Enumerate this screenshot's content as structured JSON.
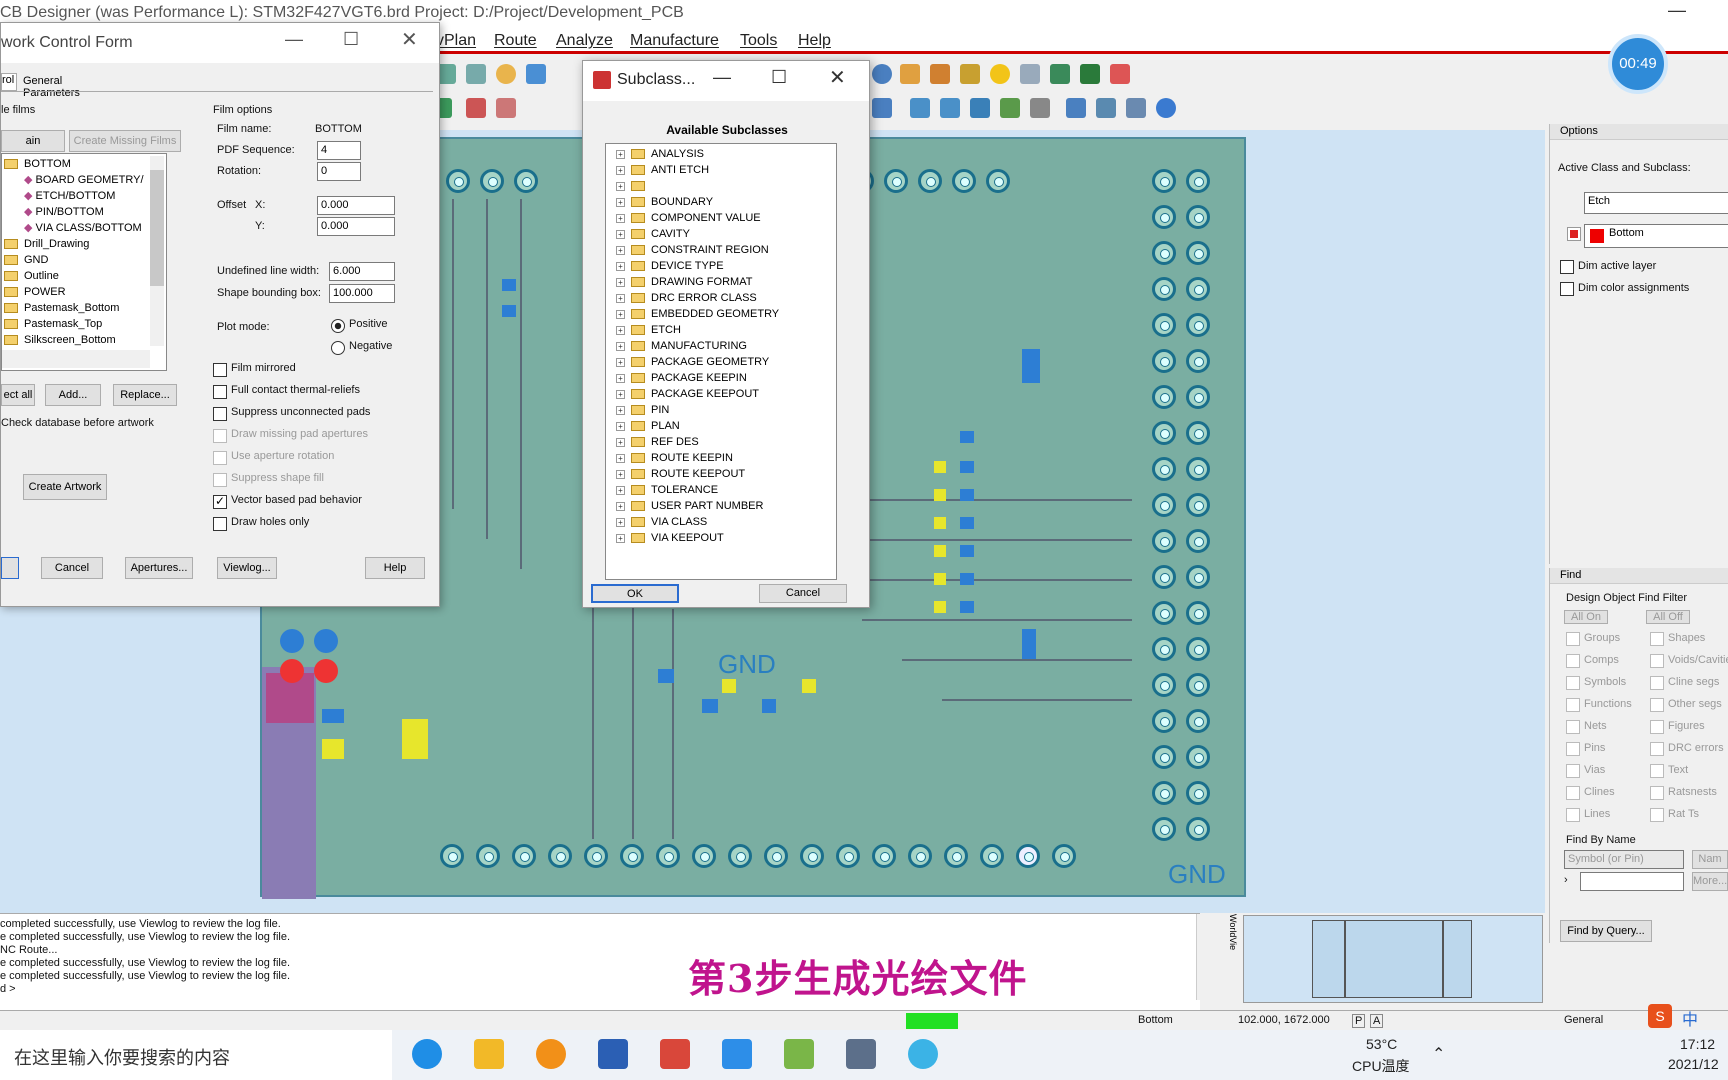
{
  "window": {
    "title": "CB Designer (was Performance L): STM32F427VGT6.brd  Project: D:/Project/Development_PCB"
  },
  "menu": {
    "items": [
      "vPlan",
      "Route",
      "Analyze",
      "Manufacture",
      "Tools",
      "Help"
    ]
  },
  "timer": "00:49",
  "artwork": {
    "title": "work Control Form",
    "tabs": [
      "rol",
      "General Parameters"
    ],
    "films_label": "le films",
    "btn_main_selection": "ain Selection",
    "btn_create_missing": "Create Missing Films",
    "films": [
      "BOTTOM",
      "BOARD GEOMETRY/",
      "ETCH/BOTTOM",
      "PIN/BOTTOM",
      "VIA CLASS/BOTTOM",
      "Drill_Drawing",
      "GND",
      "Outline",
      "POWER",
      "Pastemask_Bottom",
      "Pastemask_Top",
      "Silkscreen_Bottom"
    ],
    "film_options_label": "Film options",
    "film_name_label": "Film name:",
    "film_name": "BOTTOM",
    "pdf_seq_label": "PDF Sequence:",
    "pdf_seq": "4",
    "rotation_label": "Rotation:",
    "rotation": "0",
    "offset_label": "Offset",
    "x_label": "X:",
    "y_label": "Y:",
    "offset_x": "0.000",
    "offset_y": "0.000",
    "undef_width_label": "Undefined line width:",
    "undef_width": "6.000",
    "shape_box_label": "Shape bounding box:",
    "shape_box": "100.000",
    "plot_mode_label": "Plot mode:",
    "positive": "Positive",
    "negative": "Negative",
    "checks": [
      "Film mirrored",
      "Full contact thermal-reliefs",
      "Suppress unconnected pads",
      "Draw missing pad apertures",
      "Use aperture rotation",
      "Suppress shape fill",
      "Vector based pad behavior",
      "Draw holes only"
    ],
    "btn_select_all": "ect all",
    "btn_add": "Add...",
    "btn_replace": "Replace...",
    "check_db": "Check database before artwork",
    "btn_create_artwork": "Create Artwork",
    "btn_cancel": "Cancel",
    "btn_apertures": "Apertures...",
    "btn_viewlog": "Viewlog...",
    "btn_help": "Help"
  },
  "subclass": {
    "title": "Subclass...",
    "heading": "Available Subclasses",
    "items": [
      "ANALYSIS",
      "ANTI ETCH",
      "",
      "BOUNDARY",
      "COMPONENT VALUE",
      "CAVITY",
      "CONSTRAINT REGION",
      "DEVICE TYPE",
      "DRAWING FORMAT",
      "DRC ERROR CLASS",
      "EMBEDDED GEOMETRY",
      "ETCH",
      "MANUFACTURING",
      "PACKAGE GEOMETRY",
      "PACKAGE KEEPIN",
      "PACKAGE KEEPOUT",
      "PIN",
      "PLAN",
      "REF DES",
      "ROUTE KEEPIN",
      "ROUTE KEEPOUT",
      "TOLERANCE",
      "USER PART NUMBER",
      "VIA CLASS",
      "VIA KEEPOUT"
    ],
    "ok": "OK",
    "cancel": "Cancel"
  },
  "options": {
    "title": "Options",
    "active_label": "Active Class and Subclass:",
    "class": "Etch",
    "subclass": "Bottom",
    "dim_active": "Dim active layer",
    "dim_color": "Dim color assignments"
  },
  "find": {
    "title": "Find",
    "filter_title": "Design Object Find Filter",
    "all_on": "All On",
    "all_off": "All Off",
    "left": [
      "Groups",
      "Comps",
      "Symbols",
      "Functions",
      "Nets",
      "Pins",
      "Vias",
      "Clines",
      "Lines"
    ],
    "right": [
      "Shapes",
      "Voids/Cavitie",
      "Cline segs",
      "Other segs",
      "Figures",
      "DRC errors",
      "Text",
      "Ratsnests",
      "Rat Ts"
    ],
    "by_name": "Find By Name",
    "name_type": "Symbol (or Pin)",
    "name_btn": "Nam",
    "more": "More...",
    "query": "Find by Query..."
  },
  "console": {
    "lines": [
      "completed successfully, use Viewlog to review the log file.",
      "e completed successfully, use Viewlog to review the log file.",
      "NC Route...",
      "e completed successfully, use Viewlog to review the log file.",
      "e completed successfully, use Viewlog to review the log file.",
      "d >"
    ]
  },
  "caption": "第3步生成光绘文件",
  "board_labels": {
    "gnd1": "GND",
    "gnd2": "GND"
  },
  "worldview": "WorldVie",
  "status": {
    "layer": "Bottom",
    "coords": "102.000, 1672.000",
    "p": "P",
    "a": "A",
    "general": "General"
  },
  "taskbar": {
    "search": "在这里输入你要搜索的内容",
    "temp": "53°C",
    "cpu": "CPU温度",
    "time": "17:12",
    "date": "2021/12",
    "ime": "中"
  }
}
